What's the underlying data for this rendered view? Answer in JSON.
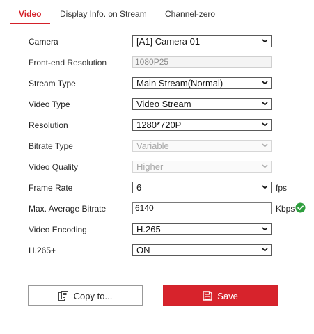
{
  "tabs": [
    {
      "label": "Video",
      "active": true
    },
    {
      "label": "Display Info. on Stream",
      "active": false
    },
    {
      "label": "Channel-zero",
      "active": false
    }
  ],
  "form": {
    "camera": {
      "label": "Camera",
      "value": "[A1] Camera 01"
    },
    "frontend_resolution": {
      "label": "Front-end Resolution",
      "value": "1080P25"
    },
    "stream_type": {
      "label": "Stream Type",
      "value": "Main Stream(Normal)"
    },
    "video_type": {
      "label": "Video Type",
      "value": "Video Stream"
    },
    "resolution": {
      "label": "Resolution",
      "value": "1280*720P"
    },
    "bitrate_type": {
      "label": "Bitrate Type",
      "value": "Variable"
    },
    "video_quality": {
      "label": "Video Quality",
      "value": "Higher"
    },
    "frame_rate": {
      "label": "Frame Rate",
      "value": "6",
      "unit": "fps"
    },
    "max_avg_bitrate": {
      "label": "Max. Average Bitrate",
      "value": "6140",
      "unit": "Kbps"
    },
    "video_encoding": {
      "label": "Video Encoding",
      "value": "H.265"
    },
    "h265_plus": {
      "label": "H.265+",
      "value": "ON"
    }
  },
  "buttons": {
    "copy_label": "Copy to...",
    "save_label": "Save"
  },
  "colors": {
    "accent": "#d42029",
    "ok": "#2e9e3e"
  }
}
